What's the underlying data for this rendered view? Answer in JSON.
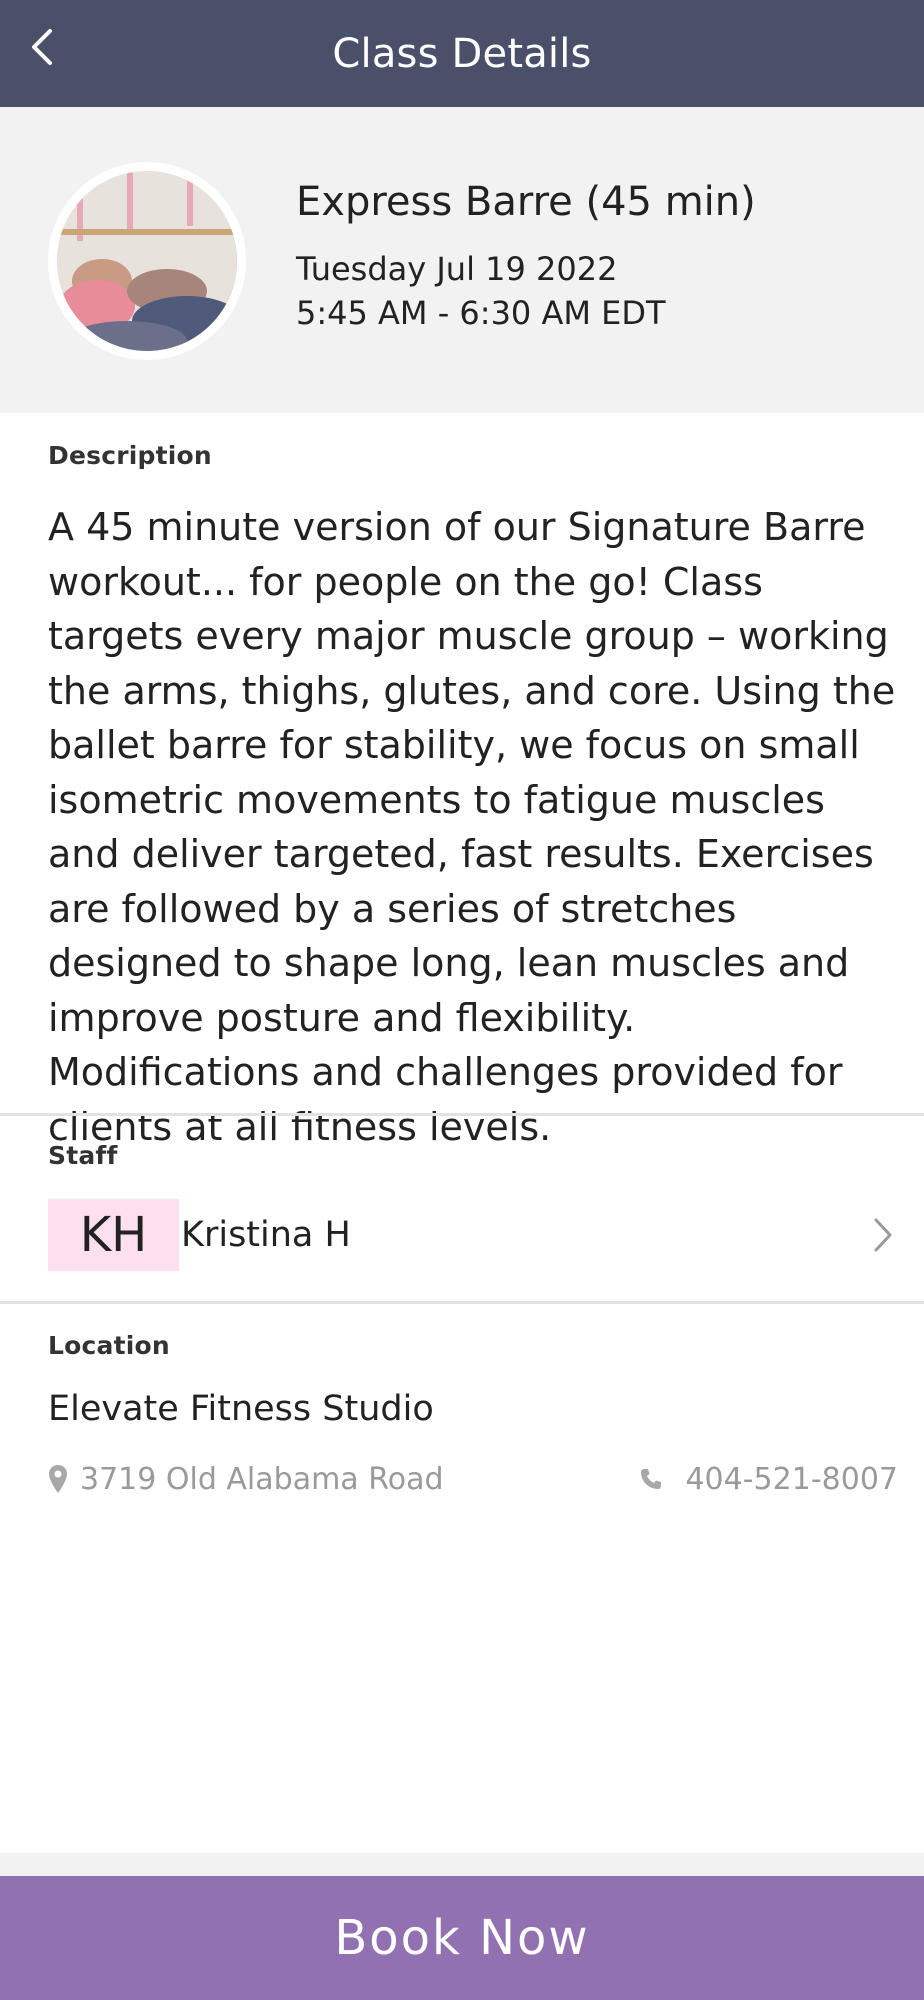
{
  "header": {
    "title": "Class Details"
  },
  "class_info": {
    "name": "Express Barre (45 min)",
    "date": "Tuesday Jul 19 2022",
    "time": "5:45 AM - 6:30 AM EDT"
  },
  "description": {
    "label": "Description",
    "text": "A 45 minute version of our Signature Barre workout... for people on the go! Class targets every major muscle group – working the arms, thighs, glutes, and core. Using the ballet barre for stability, we focus on small isometric movements to fatigue muscles and deliver targeted, fast results. Exercises are followed by a series of stretches designed to shape long, lean muscles and improve posture and flexibility. Modifications and challenges provided for clients at all fitness levels."
  },
  "staff": {
    "label": "Staff",
    "initials": "KH",
    "name": "Kristina H"
  },
  "location": {
    "label": "Location",
    "studio": "Elevate Fitness Studio",
    "address": "3719 Old Alabama Road",
    "phone": "404-521-8007"
  },
  "actions": {
    "book_label": "Book Now"
  },
  "colors": {
    "header_bg": "#4a5069",
    "accent_button": "#9271b3",
    "initials_bg": "#fde0ef"
  },
  "icons": {
    "back": "chevron-left-icon",
    "staff_chevron": "chevron-right-icon",
    "address": "map-pin-icon",
    "phone": "phone-icon"
  }
}
